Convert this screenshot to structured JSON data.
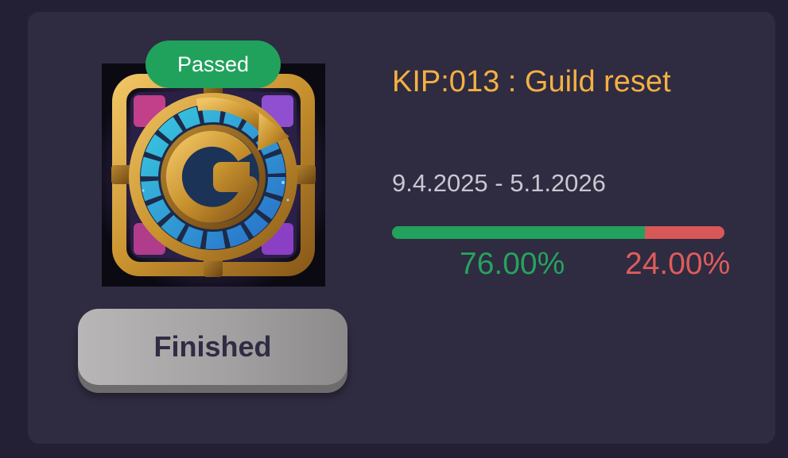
{
  "proposal": {
    "title": "KIP:013 : Guild reset",
    "date_range": "9.4.2025 - 5.1.2026",
    "result_badge": "Passed",
    "status_button": "Finished",
    "image_icon": "guild-reset-emblem",
    "votes": {
      "yes_percent": 76.0,
      "no_percent": 24.0,
      "yes_label": "76.00%",
      "no_label": "24.00%"
    }
  },
  "colors": {
    "page_background": "#231f35",
    "card_background": "#2f2b41",
    "title": "#f4b042",
    "badge": "#21a25c",
    "yes": "#22a15c",
    "no": "#d85857",
    "button": "#a3a1a1",
    "button_text": "#2f2c43"
  }
}
